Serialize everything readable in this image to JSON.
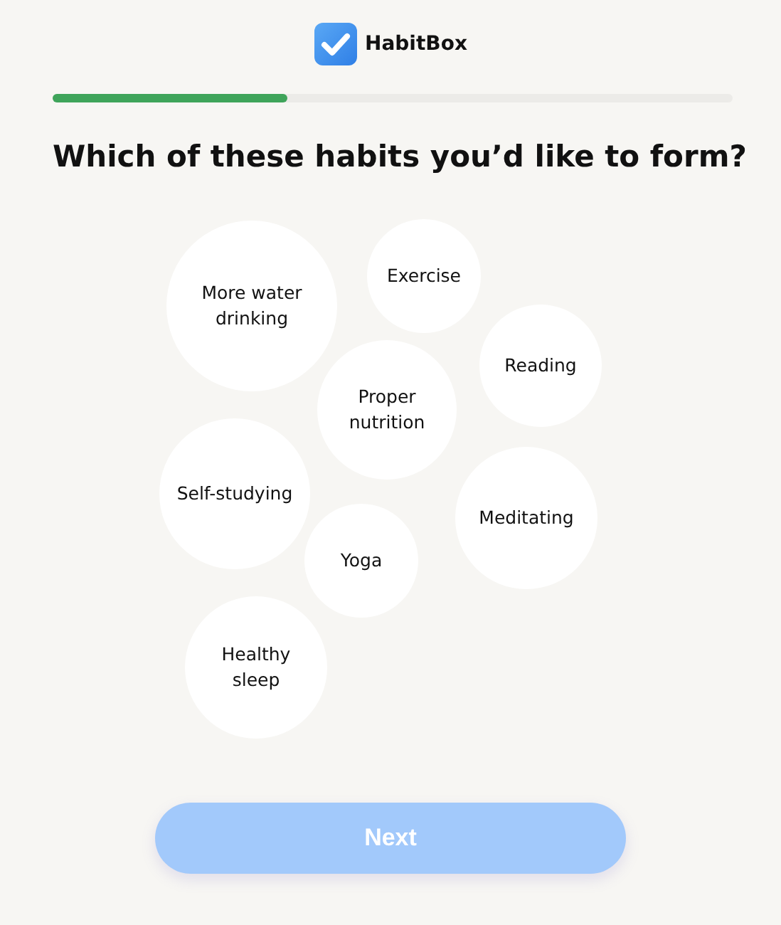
{
  "brand": {
    "name": "HabitBox"
  },
  "progress": {
    "level": 0.345
  },
  "question": "Which of these habits you’d like to form?",
  "habits": [
    {
      "label": "More water drinking",
      "selected": false
    },
    {
      "label": "Exercise",
      "selected": false
    },
    {
      "label": "Reading",
      "selected": false
    },
    {
      "label": "Proper nutrition",
      "selected": false
    },
    {
      "label": "Self-studying",
      "selected": false
    },
    {
      "label": "Meditating",
      "selected": false
    },
    {
      "label": "Yoga",
      "selected": false
    },
    {
      "label": "Healthy sleep",
      "selected": false
    }
  ],
  "next_button": {
    "label": "Next",
    "disabled": true
  }
}
